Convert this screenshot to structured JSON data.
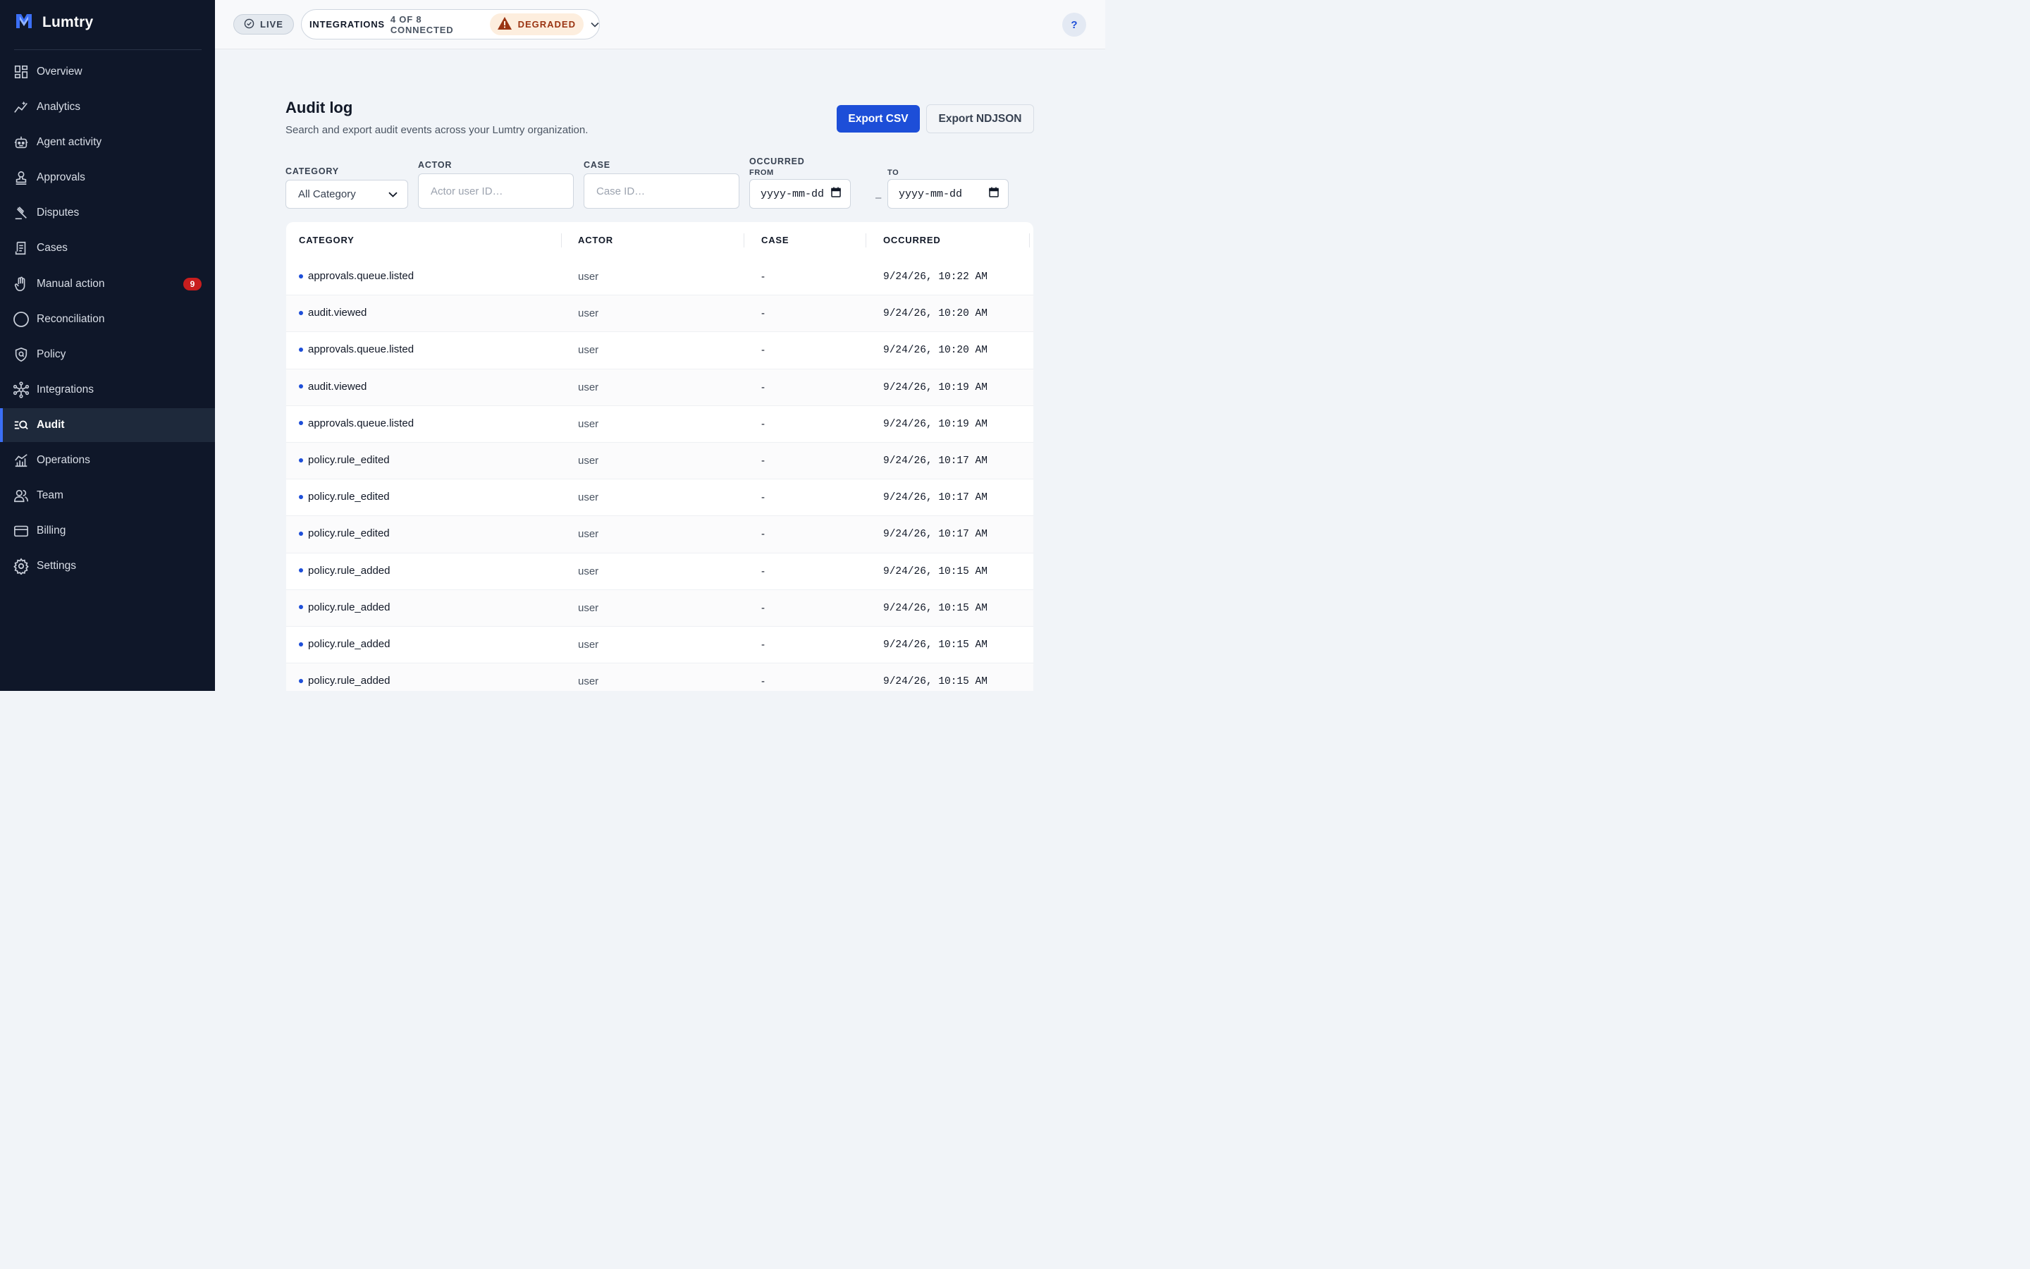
{
  "brand": {
    "name": "Lumtry"
  },
  "sidebar": {
    "items": [
      {
        "label": "Overview",
        "icon": "dashboard-icon"
      },
      {
        "label": "Analytics",
        "icon": "analytics-icon"
      },
      {
        "label": "Agent activity",
        "icon": "robot-icon"
      },
      {
        "label": "Approvals",
        "icon": "stamp-icon"
      },
      {
        "label": "Disputes",
        "icon": "gavel-icon"
      },
      {
        "label": "Cases",
        "icon": "receipt-icon"
      },
      {
        "label": "Manual action",
        "icon": "hand-icon",
        "badge": "9"
      },
      {
        "label": "Reconciliation",
        "icon": "circle-icon"
      },
      {
        "label": "Policy",
        "icon": "shield-icon"
      },
      {
        "label": "Integrations",
        "icon": "network-icon"
      },
      {
        "label": "Audit",
        "icon": "audit-search-icon",
        "active": true
      },
      {
        "label": "Operations",
        "icon": "chart-icon"
      },
      {
        "label": "Team",
        "icon": "users-icon"
      },
      {
        "label": "Billing",
        "icon": "card-icon"
      },
      {
        "label": "Settings",
        "icon": "gear-icon"
      }
    ]
  },
  "topbar": {
    "live_label": "LIVE",
    "integrations_label": "INTEGRATIONS",
    "integrations_count": "4 OF 8 CONNECTED",
    "status_label": "DEGRADED",
    "help_label": "?"
  },
  "header": {
    "title": "Audit log",
    "subtitle": "Search and export audit events across your Lumtry organization.",
    "export_csv": "Export CSV",
    "export_ndjson": "Export NDJSON"
  },
  "filters": {
    "category_label": "CATEGORY",
    "category_value": "All Category",
    "actor_label": "ACTOR",
    "actor_placeholder": "Actor user ID…",
    "case_label": "CASE",
    "case_placeholder": "Case ID…",
    "occurred_label": "OCCURRED",
    "from_label": "FROM",
    "to_label": "TO",
    "date_placeholder": "yyyy-mm-dd",
    "range_separator": "–"
  },
  "table": {
    "columns": [
      "CATEGORY",
      "ACTOR",
      "CASE",
      "OCCURRED"
    ],
    "rows": [
      {
        "category": "approvals.queue.listed",
        "actor": "user",
        "case": "-",
        "occurred": "9/24/26, 10:22 AM"
      },
      {
        "category": "audit.viewed",
        "actor": "user",
        "case": "-",
        "occurred": "9/24/26, 10:20 AM"
      },
      {
        "category": "approvals.queue.listed",
        "actor": "user",
        "case": "-",
        "occurred": "9/24/26, 10:20 AM"
      },
      {
        "category": "audit.viewed",
        "actor": "user",
        "case": "-",
        "occurred": "9/24/26, 10:19 AM"
      },
      {
        "category": "approvals.queue.listed",
        "actor": "user",
        "case": "-",
        "occurred": "9/24/26, 10:19 AM"
      },
      {
        "category": "policy.rule_edited",
        "actor": "user",
        "case": "-",
        "occurred": "9/24/26, 10:17 AM"
      },
      {
        "category": "policy.rule_edited",
        "actor": "user",
        "case": "-",
        "occurred": "9/24/26, 10:17 AM"
      },
      {
        "category": "policy.rule_edited",
        "actor": "user",
        "case": "-",
        "occurred": "9/24/26, 10:17 AM"
      },
      {
        "category": "policy.rule_added",
        "actor": "user",
        "case": "-",
        "occurred": "9/24/26, 10:15 AM"
      },
      {
        "category": "policy.rule_added",
        "actor": "user",
        "case": "-",
        "occurred": "9/24/26, 10:15 AM"
      },
      {
        "category": "policy.rule_added",
        "actor": "user",
        "case": "-",
        "occurred": "9/24/26, 10:15 AM"
      },
      {
        "category": "policy.rule_added",
        "actor": "user",
        "case": "-",
        "occurred": "9/24/26, 10:15 AM"
      }
    ]
  },
  "colors": {
    "sidebar_bg": "#0f1729",
    "accent": "#1d4ed8",
    "badge": "#c81e1e",
    "degraded_bg": "#fdeede",
    "degraded_text": "#9a3412"
  }
}
